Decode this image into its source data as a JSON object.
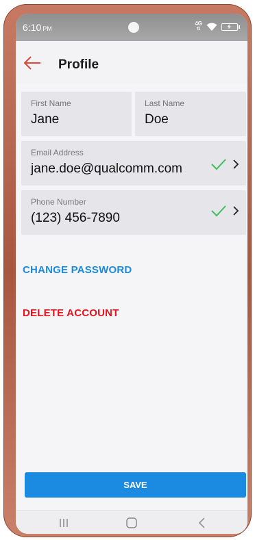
{
  "status_bar": {
    "time": "6:10",
    "ampm": "PM",
    "network": "4G"
  },
  "header": {
    "title": "Profile"
  },
  "form": {
    "first_name": {
      "label": "First Name",
      "value": "Jane"
    },
    "last_name": {
      "label": "Last Name",
      "value": "Doe"
    },
    "email": {
      "label": "Email Address",
      "value": "jane.doe@qualcomm.com"
    },
    "phone": {
      "label": "Phone Number",
      "value": "(123) 456-7890"
    }
  },
  "actions": {
    "change_password": "CHANGE PASSWORD",
    "delete_account": "DELETE ACCOUNT",
    "save": "SAVE"
  },
  "colors": {
    "accent": "#1a8be0",
    "link_blue": "#1a8be0",
    "danger_red": "#e8141d",
    "check_green": "#3cc05a",
    "back_arrow": "#e0473c"
  },
  "icons": {
    "back": "arrow-left-icon",
    "check": "check-icon",
    "chevron": "chevron-right-icon",
    "wifi": "wifi-icon",
    "battery": "battery-icon",
    "nav_recents": "recents-icon",
    "nav_home": "home-icon",
    "nav_back": "back-icon"
  }
}
